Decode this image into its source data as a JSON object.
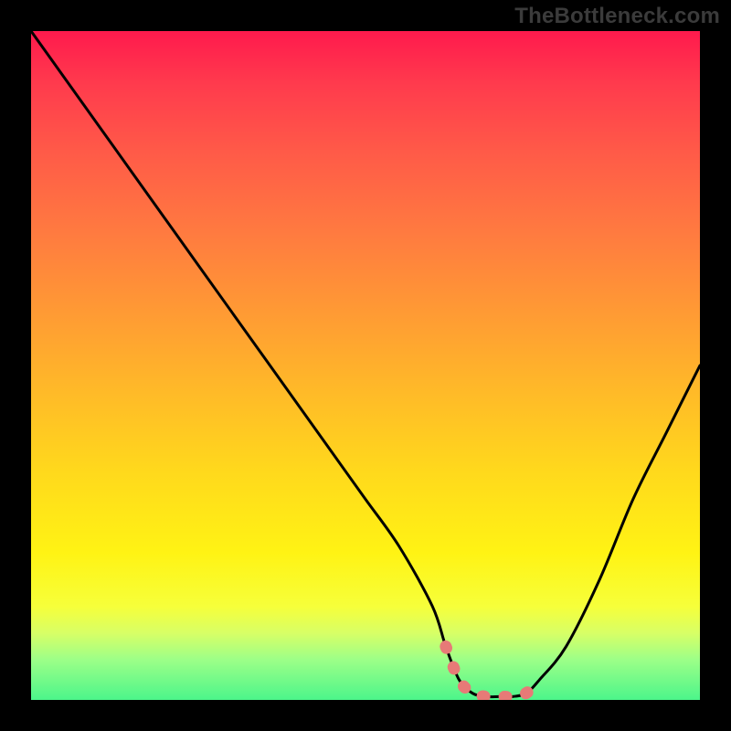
{
  "watermark": "TheBottleneck.com",
  "chart_data": {
    "type": "line",
    "title": "",
    "xlabel": "",
    "ylabel": "",
    "xlim": [
      0,
      100
    ],
    "ylim": [
      0,
      100
    ],
    "series": [
      {
        "name": "curve",
        "x": [
          0,
          5,
          10,
          15,
          20,
          25,
          30,
          35,
          40,
          45,
          50,
          55,
          60,
          62,
          64,
          66,
          68,
          70,
          72,
          74,
          76,
          80,
          85,
          90,
          95,
          100
        ],
        "y": [
          100,
          93,
          86,
          79,
          72,
          65,
          58,
          51,
          44,
          37,
          30,
          23,
          14,
          8,
          3,
          1,
          0.5,
          0.5,
          0.5,
          1,
          3,
          8,
          18,
          30,
          40,
          50
        ]
      }
    ],
    "highlight_segment": {
      "name": "optimal-range",
      "x": [
        62,
        64,
        66,
        68,
        70,
        72,
        74,
        76
      ],
      "y": [
        8,
        3,
        1,
        0.5,
        0.5,
        0.5,
        1,
        3
      ]
    },
    "gradient_stops": [
      {
        "pos": 0.0,
        "color": "#ff1a4d"
      },
      {
        "pos": 0.5,
        "color": "#ffba28"
      },
      {
        "pos": 0.8,
        "color": "#fff314"
      },
      {
        "pos": 1.0,
        "color": "#4cf58a"
      }
    ]
  }
}
